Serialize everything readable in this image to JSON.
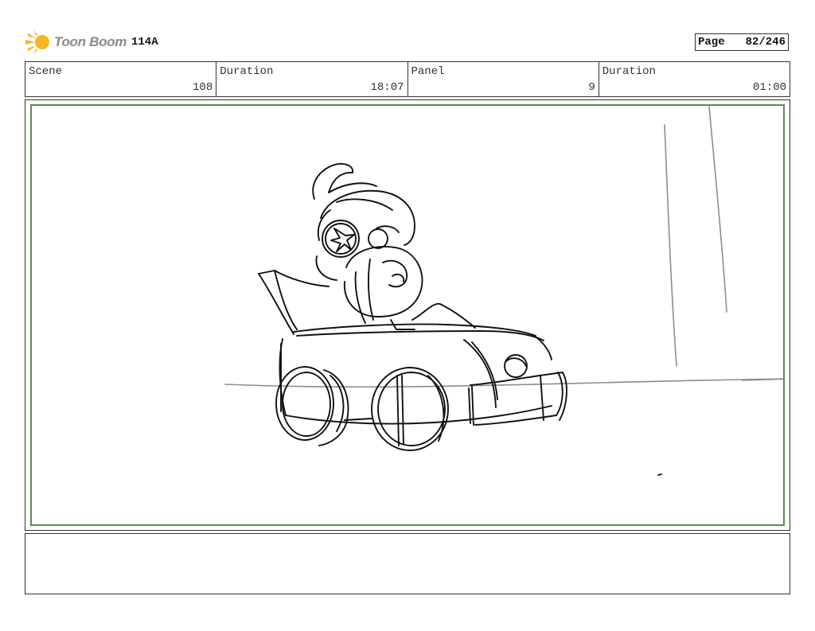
{
  "header": {
    "logo_text": "Toon Boom",
    "project": "114A",
    "page_label": "Page",
    "page_value": "82/246"
  },
  "info": [
    {
      "label": "Scene",
      "value": "108"
    },
    {
      "label": "Duration",
      "value": "18:07"
    },
    {
      "label": "Panel",
      "value": "9"
    },
    {
      "label": "Duration",
      "value": "01:00"
    }
  ],
  "colors": {
    "logo_accent": "#f2b81f",
    "panel_frame": "#5c8a52",
    "sketch": "#111111"
  },
  "panel": {
    "image": "rough-sketch-character-in-kart"
  },
  "notes": {
    "text": ""
  }
}
